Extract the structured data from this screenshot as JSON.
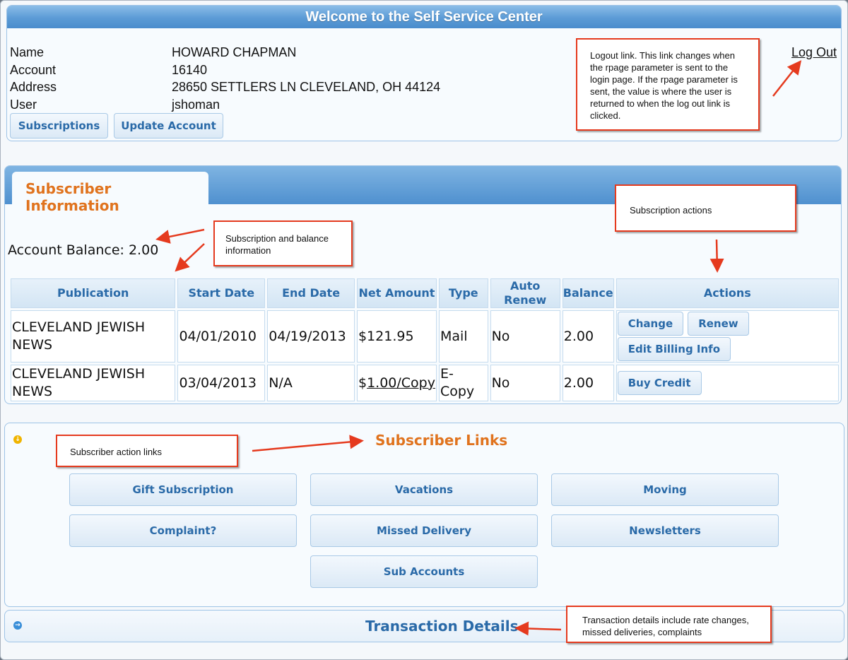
{
  "header": {
    "title": "Welcome to the Self Service Center",
    "logout_label": "Log Out",
    "fields": [
      {
        "label": "Name",
        "value": "HOWARD CHAPMAN"
      },
      {
        "label": "Account",
        "value": "16140"
      },
      {
        "label": "Address",
        "value": "28650 SETTLERS LN CLEVELAND, OH 44124"
      },
      {
        "label": "User",
        "value": "jshoman"
      }
    ],
    "buttons": {
      "subscriptions": "Subscriptions",
      "update_account": "Update Account"
    }
  },
  "subscriber_info": {
    "tab_label": "Subscriber Information",
    "account_balance": "Account Balance: 2.00",
    "columns": [
      "Publication",
      "Start Date",
      "End Date",
      "Net Amount",
      "Type",
      "Auto Renew",
      "Balance",
      "Actions"
    ],
    "rows": [
      {
        "publication": "CLEVELAND JEWISH NEWS",
        "start_date": "04/01/2010",
        "end_date": "04/19/2013",
        "net_amount": "$121.95",
        "type": "Mail",
        "auto_renew": "No",
        "balance": "2.00",
        "actions": [
          "Change",
          "Renew",
          "Edit Billing Info"
        ]
      },
      {
        "publication": "CLEVELAND JEWISH NEWS",
        "start_date": "03/04/2013",
        "end_date": "N/A",
        "net_amount_prefix": "$",
        "net_amount_link": "1.00/Copy",
        "type": "E-Copy",
        "auto_renew": "No",
        "balance": "2.00",
        "actions": [
          "Buy Credit"
        ]
      }
    ]
  },
  "subscriber_links": {
    "title": "Subscriber Links",
    "links": [
      "Gift Subscription",
      "Vacations",
      "Moving",
      "Complaint?",
      "Missed Delivery",
      "Newsletters",
      "Sub Accounts"
    ]
  },
  "transaction_details": {
    "title": "Transaction Details"
  },
  "annotations": {
    "logout": "Logout link.  This link changes when the rpage parameter is sent to the login page.  If the rpage parameter is sent, the value is where the user is returned to when the log out link is clicked.",
    "balance": "Subscription and balance information",
    "actions": "Subscription actions",
    "links": "Subscriber action links",
    "transactions": "Transaction details include rate changes, missed deliveries, complaints"
  },
  "colors": {
    "accent_orange": "#e0731e",
    "link_blue": "#2a6aa8",
    "annotation_red": "#e53a1e",
    "no_red": "#e51c1c",
    "expand_icon_orange": "#f0b400",
    "collapse_icon_blue": "#3a8fd8"
  },
  "icons": {
    "links_toggle": "expand-down-icon",
    "transactions_toggle": "expand-right-icon"
  }
}
